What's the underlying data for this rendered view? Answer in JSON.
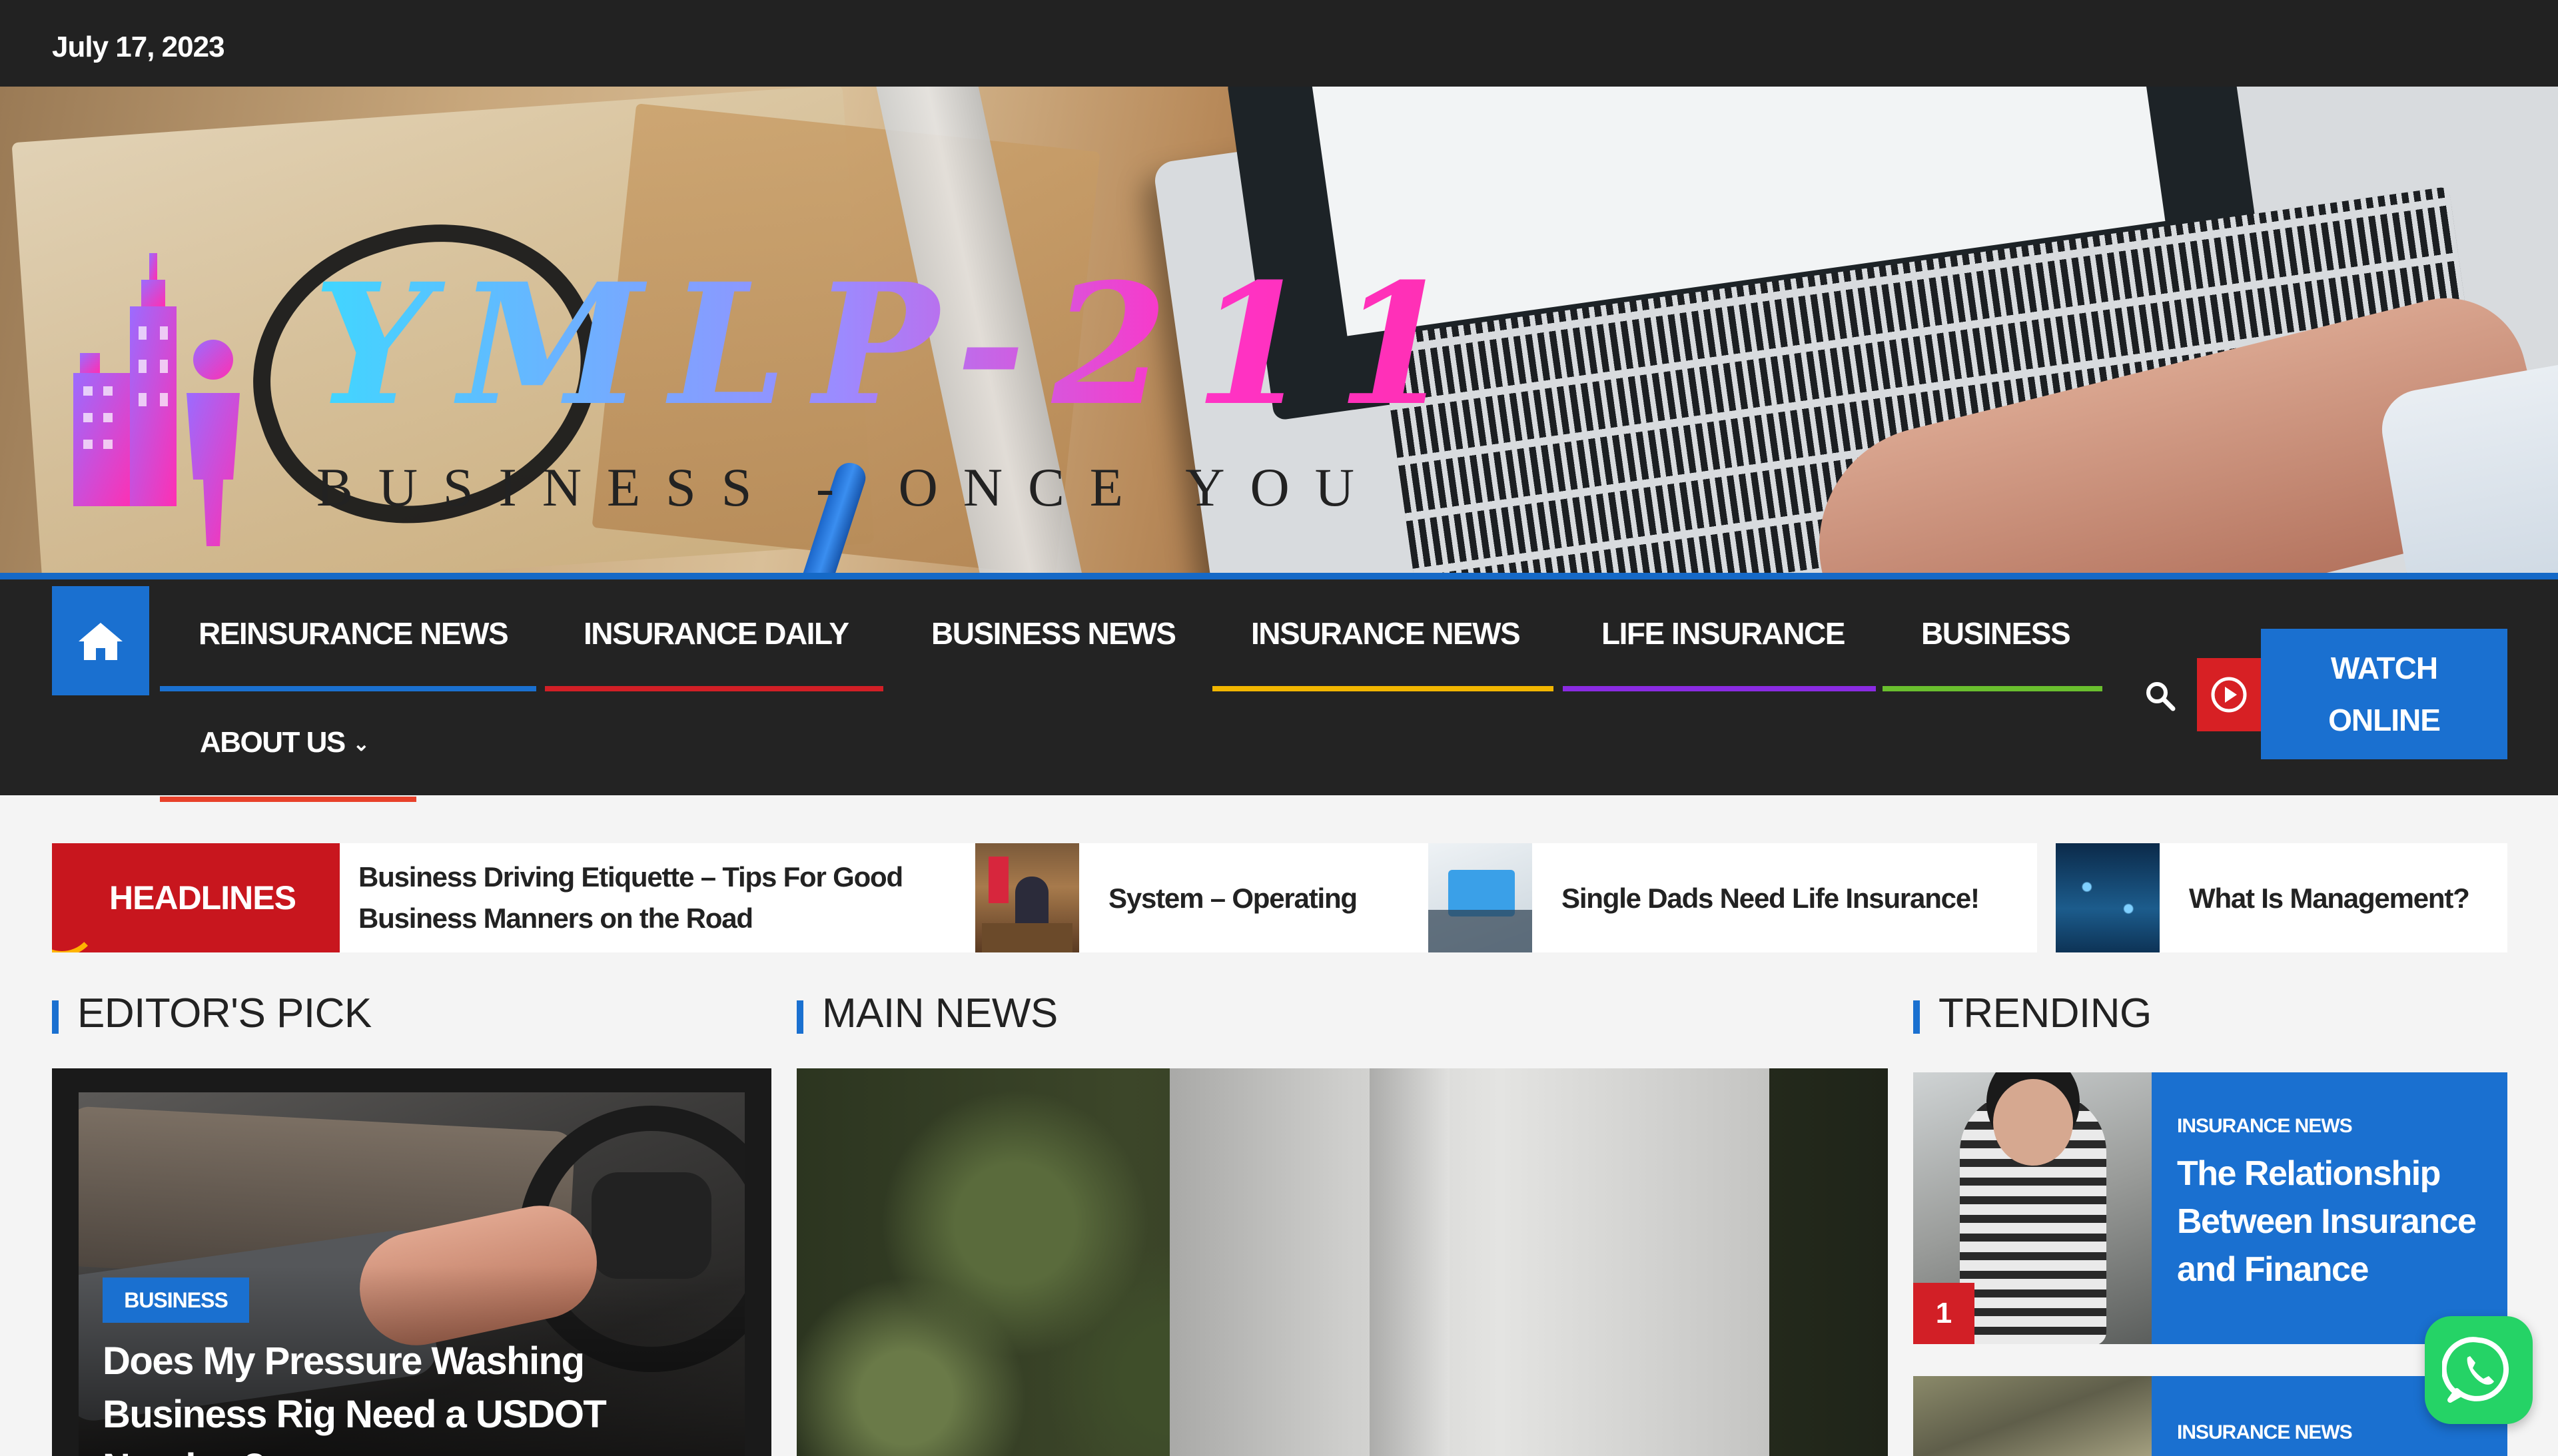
{
  "topbar": {
    "date": "July 17, 2023"
  },
  "brand": {
    "title": "YMLP-211",
    "tagline": "BUSINESS - ONCE YOU"
  },
  "nav": {
    "items": [
      {
        "label": "REINSURANCE NEWS",
        "color": "#1a70d0"
      },
      {
        "label": "INSURANCE DAILY",
        "color": "#d21f26"
      },
      {
        "label": "BUSINESS NEWS",
        "color": ""
      },
      {
        "label": "INSURANCE NEWS",
        "color": "#f2b600"
      },
      {
        "label": "LIFE INSURANCE",
        "color": "#8a2be2"
      },
      {
        "label": "BUSINESS",
        "color": "#6abf2e"
      }
    ],
    "about": {
      "label": "ABOUT US",
      "color": "#e8412a"
    },
    "watch_line1": "WATCH",
    "watch_line2": "ONLINE"
  },
  "ticker": {
    "label": "HEADLINES",
    "items": [
      {
        "line1": "Business Driving Etiquette – Tips For Good",
        "line2": "Business Manners on the Road"
      },
      {
        "line1": "System – Operating"
      },
      {
        "line1": "Single Dads Need Life Insurance!"
      },
      {
        "line1": "What Is Management?"
      }
    ]
  },
  "sections": {
    "editors_pick": "EDITOR'S PICK",
    "main_news": "MAIN NEWS",
    "trending": "TRENDING"
  },
  "editors_pick": {
    "category": "BUSINESS",
    "title_line1": "Does My Pressure Washing",
    "title_line2": "Business Rig Need a USDOT",
    "title_line3": "Number?"
  },
  "trending": [
    {
      "rank": "1",
      "category": "INSURANCE NEWS",
      "title_line1": "The Relationship",
      "title_line2": "Between Insurance",
      "title_line3": "and Finance"
    },
    {
      "category": "INSURANCE NEWS"
    }
  ],
  "colors": {
    "accent_blue": "#1a70d0",
    "accent_red": "#d21f26",
    "nav_bg": "#232323",
    "whatsapp": "#25d366"
  }
}
